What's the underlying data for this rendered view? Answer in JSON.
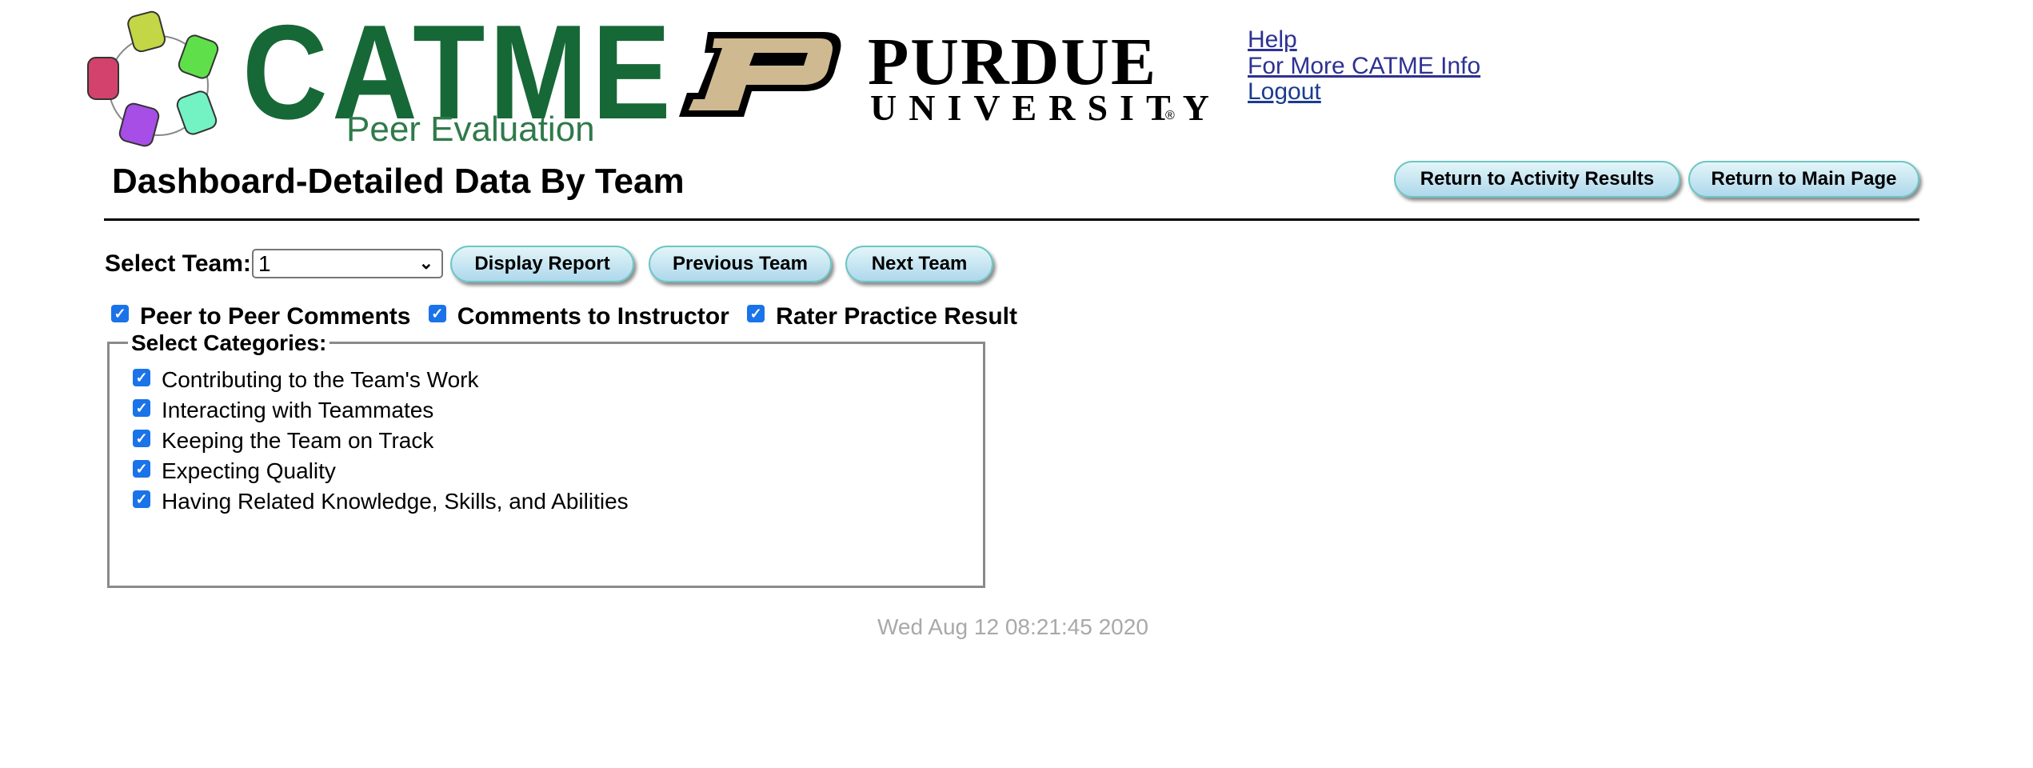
{
  "header": {
    "catme_logo": {
      "word": "CATME",
      "subtitle": "Peer Evaluation",
      "colors": [
        "#c3d645",
        "#5fe04a",
        "#73f2c4",
        "#a64ee5",
        "#d3426c"
      ]
    },
    "purdue_logo": {
      "word": "PURDUE",
      "subtitle": "UNIVERSITY",
      "registered": "®",
      "gold": "#cfb991"
    },
    "links": [
      {
        "label": "Help"
      },
      {
        "label": "For More CATME Info"
      },
      {
        "label": "Logout"
      }
    ]
  },
  "page": {
    "title": "Dashboard-Detailed Data By Team",
    "nav_buttons": {
      "return_activity": "Return to Activity Results",
      "return_main": "Return to Main Page"
    }
  },
  "controls": {
    "select_label": "Select Team:",
    "team_select_value": "1",
    "display_report": "Display Report",
    "previous_team": "Previous Team",
    "next_team": "Next Team"
  },
  "options": [
    {
      "label": "Peer to Peer Comments",
      "checked": true
    },
    {
      "label": "Comments to Instructor",
      "checked": true
    },
    {
      "label": "Rater Practice Result",
      "checked": true
    }
  ],
  "categories": {
    "legend": "Select Categories:",
    "items": [
      {
        "label": "Contributing to the Team's Work",
        "checked": true
      },
      {
        "label": "Interacting with Teammates",
        "checked": true
      },
      {
        "label": "Keeping the Team on Track",
        "checked": true
      },
      {
        "label": "Expecting Quality",
        "checked": true
      },
      {
        "label": "Having Related Knowledge, Skills, and Abilities",
        "checked": true
      }
    ]
  },
  "footer": {
    "timestamp": "Wed Aug 12 08:21:45 2020"
  },
  "icons": {
    "check": "✓",
    "chevron": "⌄"
  },
  "theme": {
    "link": "#2e3192",
    "button_border": "#6cc6c4",
    "checkbox": "#1a73e8",
    "timestamp": "#a9a9a9",
    "catme_green": "#176837"
  }
}
